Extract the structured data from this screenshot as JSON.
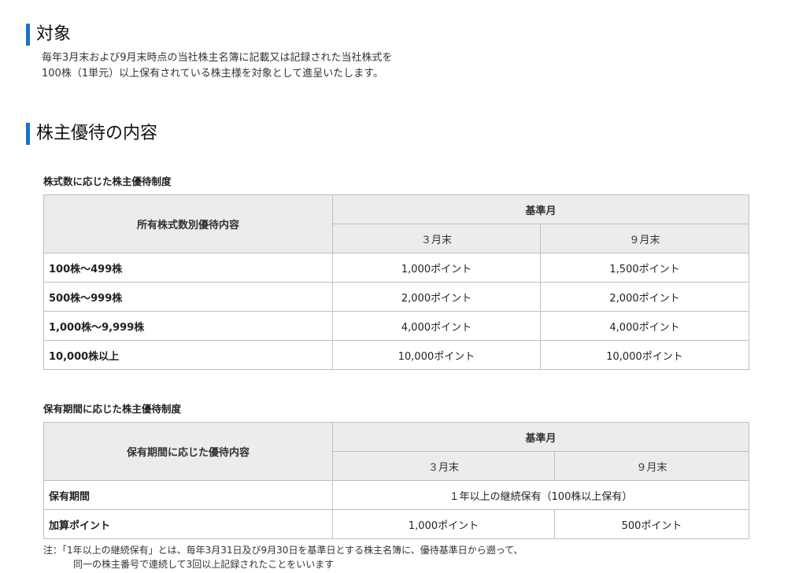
{
  "target": {
    "heading": "対象",
    "line1": "毎年3月末および9月末時点の当社株主名簿に記載又は記録された当社株式を",
    "line2": "100株（1単元）以上保有されている株主様を対象として進呈いたします。"
  },
  "perks": {
    "heading": "株主優待の内容"
  },
  "table1": {
    "title": "株式数に応じた株主優待制度",
    "row_header": "所有株式数別優待内容",
    "group_header": "基準月",
    "col1": "３月末",
    "col2": "９月末",
    "rows": [
      {
        "label": "100株～499株",
        "march": "1,000ポイント",
        "sept": "1,500ポイント"
      },
      {
        "label": "500株～999株",
        "march": "2,000ポイント",
        "sept": "2,000ポイント"
      },
      {
        "label": "1,000株～9,999株",
        "march": "4,000ポイント",
        "sept": "4,000ポイント"
      },
      {
        "label": "10,000株以上",
        "march": "10,000ポイント",
        "sept": "10,000ポイント"
      }
    ]
  },
  "table2": {
    "title": "保有期間に応じた株主優待制度",
    "row_header": "保有期間に応じた優待内容",
    "group_header": "基準月",
    "col1": "３月末",
    "col2": "９月末",
    "period_label": "保有期間",
    "period_value": "１年以上の継続保有（100株以上保有）",
    "bonus_label": "加算ポイント",
    "bonus_march": "1,000ポイント",
    "bonus_sept": "500ポイント"
  },
  "note": {
    "line1": "注：「1年以上の継続保有」とは、毎年3月31日及び9月30日を基準日とする株主名簿に、優待基準日から遡って、",
    "line2": "同一の株主番号で連続して3回以上記録されたことをいいます"
  },
  "colors": {
    "accent": "#1a73c8",
    "header_bg": "#ececec",
    "border": "#bfbfbf"
  }
}
